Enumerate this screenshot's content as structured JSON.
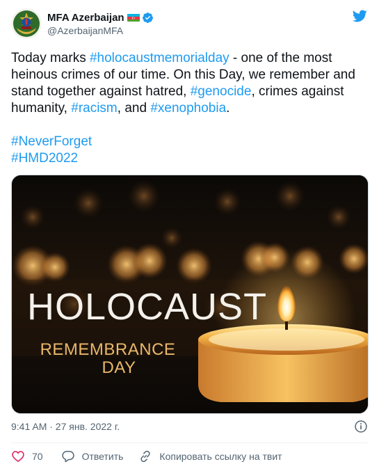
{
  "colors": {
    "accent": "#1d9bf0",
    "text": "#0f1419",
    "secondary": "#536471",
    "like_red": "#e0245e"
  },
  "author": {
    "display_name": "MFA Azerbaijan",
    "handle": "@AzerbaijanMFA",
    "flag_icon": "azerbaijan-flag-icon",
    "verified_icon": "verified-badge-icon"
  },
  "tweet": {
    "line_segments": [
      {
        "text": "Today marks ",
        "type": "text"
      },
      {
        "text": "#holocaustmemorialday",
        "type": "hashtag"
      },
      {
        "text": "  - one of the most heinous crimes of our time. On this Day, we remember and stand together against hatred, ",
        "type": "text"
      },
      {
        "text": "#genocide",
        "type": "hashtag"
      },
      {
        "text": ", crimes against humanity, ",
        "type": "text"
      },
      {
        "text": "#racism",
        "type": "hashtag"
      },
      {
        "text": ", and ",
        "type": "text"
      },
      {
        "text": "#xenophobia",
        "type": "hashtag"
      },
      {
        "text": ".",
        "type": "text"
      }
    ],
    "hashtag_never_forget": "#NeverForget",
    "hashtag_hmd": "#HMD2022"
  },
  "media": {
    "title": "HOLOCAUST",
    "subtitle_line1": "REMEMBRANCE",
    "subtitle_line2": "DAY"
  },
  "meta": {
    "timestamp": "9:41 AM · 27 янв. 2022 г.",
    "info_icon": "info-icon"
  },
  "actions": {
    "like_count": "70",
    "reply_label": "Ответить",
    "copy_link_label": "Копировать ссылку на твит"
  }
}
